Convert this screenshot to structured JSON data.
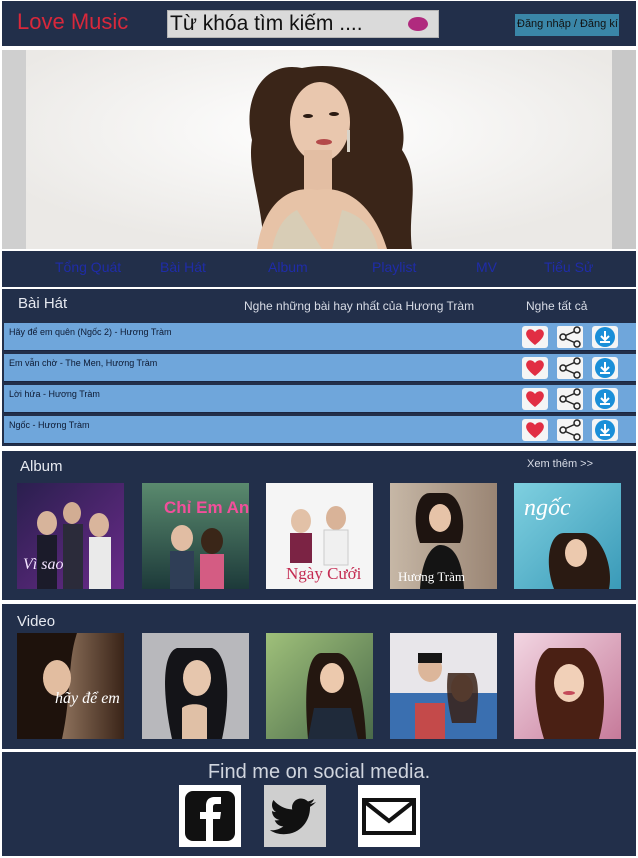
{
  "header": {
    "logo": "Love Music",
    "search_placeholder": "Từ khóa tìm kiếm ....",
    "login_label": "Đăng nhập / Đăng kí"
  },
  "nav": {
    "items": [
      "Tổng Quát",
      "Bài Hát",
      "Album",
      "Playlist",
      "MV",
      "Tiểu Sử"
    ]
  },
  "songs": {
    "title": "Bài Hát",
    "subtitle": "Nghe những bài hay nhất của Hương Tràm",
    "play_all": "Nghe tất cả",
    "list": [
      "Hãy để em quên (Ngốc 2) - Hương Tràm",
      "Em vẫn chờ - The Men, Hương Tràm",
      "Lời hứa - Hương Tràm",
      "Ngốc - Hương Tràm"
    ]
  },
  "albums": {
    "title": "Album",
    "see_more": "Xem thêm >>",
    "covers": [
      {
        "name": "album-vi-sao",
        "text": "Vì sao"
      },
      {
        "name": "album-chi-em-anh",
        "text": "Chỉ Em Anh"
      },
      {
        "name": "album-ngay-cuoi",
        "text": "Ngày Cưới"
      },
      {
        "name": "album-huong-tram",
        "text": "Hương Tràm"
      },
      {
        "name": "album-ngoc",
        "text": "ngốc"
      }
    ]
  },
  "videos": {
    "title": "Video",
    "thumbs": [
      {
        "name": "video-hay-de-em-quen",
        "text": "hãy để em quên"
      },
      {
        "name": "video-2",
        "text": ""
      },
      {
        "name": "video-3",
        "text": ""
      },
      {
        "name": "video-4",
        "text": ""
      },
      {
        "name": "video-5",
        "text": ""
      }
    ]
  },
  "footer": {
    "title": "Find me on social media.",
    "icons": [
      "facebook-icon",
      "twitter-icon",
      "mail-icon"
    ]
  },
  "colors": {
    "dark_bar": "#222f4a",
    "song_row": "#6fa6db",
    "logo_red": "#d8283b",
    "nav_blue": "#1f2ca8"
  }
}
